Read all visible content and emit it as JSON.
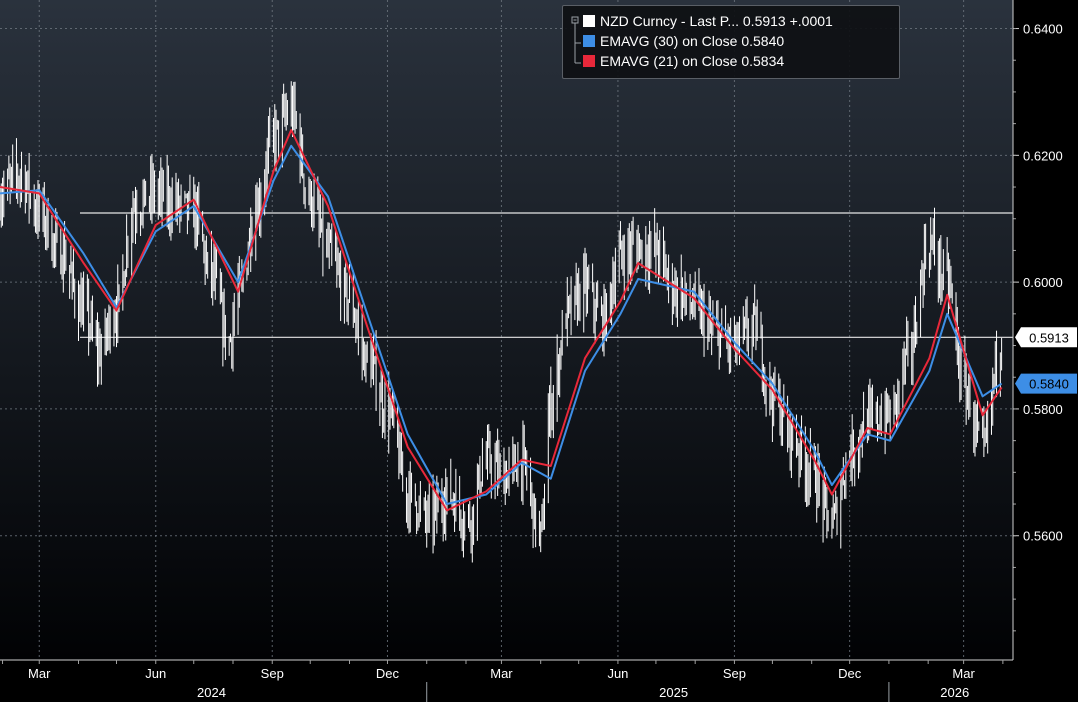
{
  "legend": {
    "rows": [
      {
        "swatch": "#ffffff",
        "text": "NZD Curncy - Last P... 0.5913 +.0001"
      },
      {
        "swatch": "#3d8ee6",
        "text": "EMAVG (30)  on Close  0.5840"
      },
      {
        "swatch": "#e8283a",
        "text": "EMAVG (21)  on Close  0.5834"
      }
    ]
  },
  "chart_data": {
    "type": "line",
    "xlim": [
      "2024-01-30",
      "2026-04-09"
    ],
    "ylim": [
      0.5404,
      0.6445
    ],
    "y_ticks": [
      0.56,
      0.58,
      0.6,
      0.62,
      0.64
    ],
    "y_tick_labels": [
      "0.5600",
      "0.5800",
      "0.6000",
      "0.6200",
      "0.6400"
    ],
    "x_month_ticks": [
      {
        "date": "2024-03-01",
        "label": "Mar"
      },
      {
        "date": "2024-06-01",
        "label": "Jun"
      },
      {
        "date": "2024-09-01",
        "label": "Sep"
      },
      {
        "date": "2024-12-01",
        "label": "Dec"
      },
      {
        "date": "2025-03-01",
        "label": "Mar"
      },
      {
        "date": "2025-06-01",
        "label": "Jun"
      },
      {
        "date": "2025-09-01",
        "label": "Sep"
      },
      {
        "date": "2025-12-01",
        "label": "Dec"
      },
      {
        "date": "2026-03-01",
        "label": "Mar"
      }
    ],
    "year_labels": [
      {
        "date": "2024-07-15",
        "label": "2024"
      },
      {
        "date": "2025-07-15",
        "label": "2025"
      },
      {
        "date": "2026-02-22",
        "label": "2026"
      }
    ],
    "year_dividers": [
      "2025-01-01",
      "2026-01-01"
    ],
    "horizontal_lines": [
      0.6109,
      0.5913
    ],
    "last_value_labels": [
      {
        "value": 0.5913,
        "label": "0.5913",
        "bg": "#ffffff",
        "fg": "#000000"
      },
      {
        "value": 0.584,
        "label": "0.5840",
        "bg": "#3d8ee6",
        "fg": "#000000"
      }
    ],
    "series": [
      {
        "name": "NZD Curncy - Last Price",
        "color": "#ffffff",
        "style": "hilo-bars",
        "x": [
          "2024-01-30",
          "2024-02-15",
          "2024-03-01",
          "2024-03-18",
          "2024-04-05",
          "2024-04-17",
          "2024-05-01",
          "2024-05-15",
          "2024-05-31",
          "2024-06-14",
          "2024-07-01",
          "2024-07-15",
          "2024-07-29",
          "2024-08-05",
          "2024-08-20",
          "2024-09-02",
          "2024-09-16",
          "2024-10-01",
          "2024-10-15",
          "2024-10-31",
          "2024-11-15",
          "2024-12-02",
          "2024-12-17",
          "2025-01-03",
          "2025-01-17",
          "2025-02-03",
          "2025-02-17",
          "2025-03-03",
          "2025-03-17",
          "2025-04-01",
          "2025-04-09",
          "2025-04-22",
          "2025-05-06",
          "2025-05-20",
          "2025-06-03",
          "2025-06-17",
          "2025-07-01",
          "2025-07-15",
          "2025-07-31",
          "2025-08-15",
          "2025-09-01",
          "2025-09-16",
          "2025-10-01",
          "2025-10-15",
          "2025-10-31",
          "2025-11-17",
          "2025-12-01",
          "2025-12-15",
          "2026-01-02",
          "2026-01-16",
          "2026-02-02",
          "2026-02-16",
          "2026-03-02",
          "2026-03-16",
          "2026-03-31"
        ],
        "y": [
          0.614,
          0.617,
          0.611,
          0.6045,
          0.5955,
          0.589,
          0.596,
          0.612,
          0.614,
          0.6125,
          0.611,
          0.601,
          0.5905,
          0.598,
          0.612,
          0.623,
          0.627,
          0.613,
          0.6045,
          0.5975,
          0.5875,
          0.5795,
          0.5665,
          0.5625,
          0.5665,
          0.5625,
          0.572,
          0.5695,
          0.5715,
          0.56,
          0.581,
          0.595,
          0.599,
          0.594,
          0.604,
          0.6055,
          0.605,
          0.599,
          0.596,
          0.592,
          0.59,
          0.593,
          0.582,
          0.576,
          0.5705,
          0.562,
          0.573,
          0.578,
          0.579,
          0.588,
          0.606,
          0.6,
          0.583,
          0.5735,
          0.5913
        ]
      },
      {
        "name": "EMAVG (30) on Close",
        "color": "#3d8ee6",
        "x": [
          "2024-01-30",
          "2024-03-01",
          "2024-04-05",
          "2024-05-01",
          "2024-06-01",
          "2024-07-01",
          "2024-08-05",
          "2024-09-02",
          "2024-09-16",
          "2024-10-15",
          "2024-11-15",
          "2024-12-17",
          "2025-01-17",
          "2025-02-17",
          "2025-03-17",
          "2025-04-09",
          "2025-05-06",
          "2025-06-03",
          "2025-06-17",
          "2025-07-31",
          "2025-09-01",
          "2025-10-01",
          "2025-11-03",
          "2025-11-17",
          "2025-12-15",
          "2026-01-02",
          "2026-02-02",
          "2026-02-16",
          "2026-03-16",
          "2026-03-31"
        ],
        "y": [
          0.614,
          0.6145,
          0.6045,
          0.596,
          0.608,
          0.612,
          0.6,
          0.616,
          0.6215,
          0.6135,
          0.595,
          0.576,
          0.565,
          0.5665,
          0.5715,
          0.569,
          0.586,
          0.595,
          0.6005,
          0.5985,
          0.5905,
          0.584,
          0.5735,
          0.568,
          0.576,
          0.575,
          0.586,
          0.595,
          0.582,
          0.584
        ]
      },
      {
        "name": "EMAVG (21) on Close",
        "color": "#e8283a",
        "x": [
          "2024-01-30",
          "2024-03-01",
          "2024-04-05",
          "2024-05-01",
          "2024-06-01",
          "2024-07-01",
          "2024-08-05",
          "2024-09-02",
          "2024-09-16",
          "2024-10-15",
          "2024-11-15",
          "2024-12-17",
          "2025-01-17",
          "2025-02-17",
          "2025-03-17",
          "2025-04-09",
          "2025-05-06",
          "2025-06-03",
          "2025-06-17",
          "2025-07-31",
          "2025-09-01",
          "2025-10-01",
          "2025-11-03",
          "2025-11-17",
          "2025-12-15",
          "2026-01-02",
          "2026-02-02",
          "2026-02-16",
          "2026-03-16",
          "2026-03-31"
        ],
        "y": [
          0.615,
          0.614,
          0.603,
          0.5955,
          0.609,
          0.613,
          0.5985,
          0.6175,
          0.624,
          0.612,
          0.593,
          0.574,
          0.564,
          0.567,
          0.572,
          0.571,
          0.588,
          0.597,
          0.603,
          0.5975,
          0.5895,
          0.583,
          0.572,
          0.5665,
          0.577,
          0.576,
          0.588,
          0.598,
          0.579,
          0.5834
        ]
      }
    ]
  }
}
